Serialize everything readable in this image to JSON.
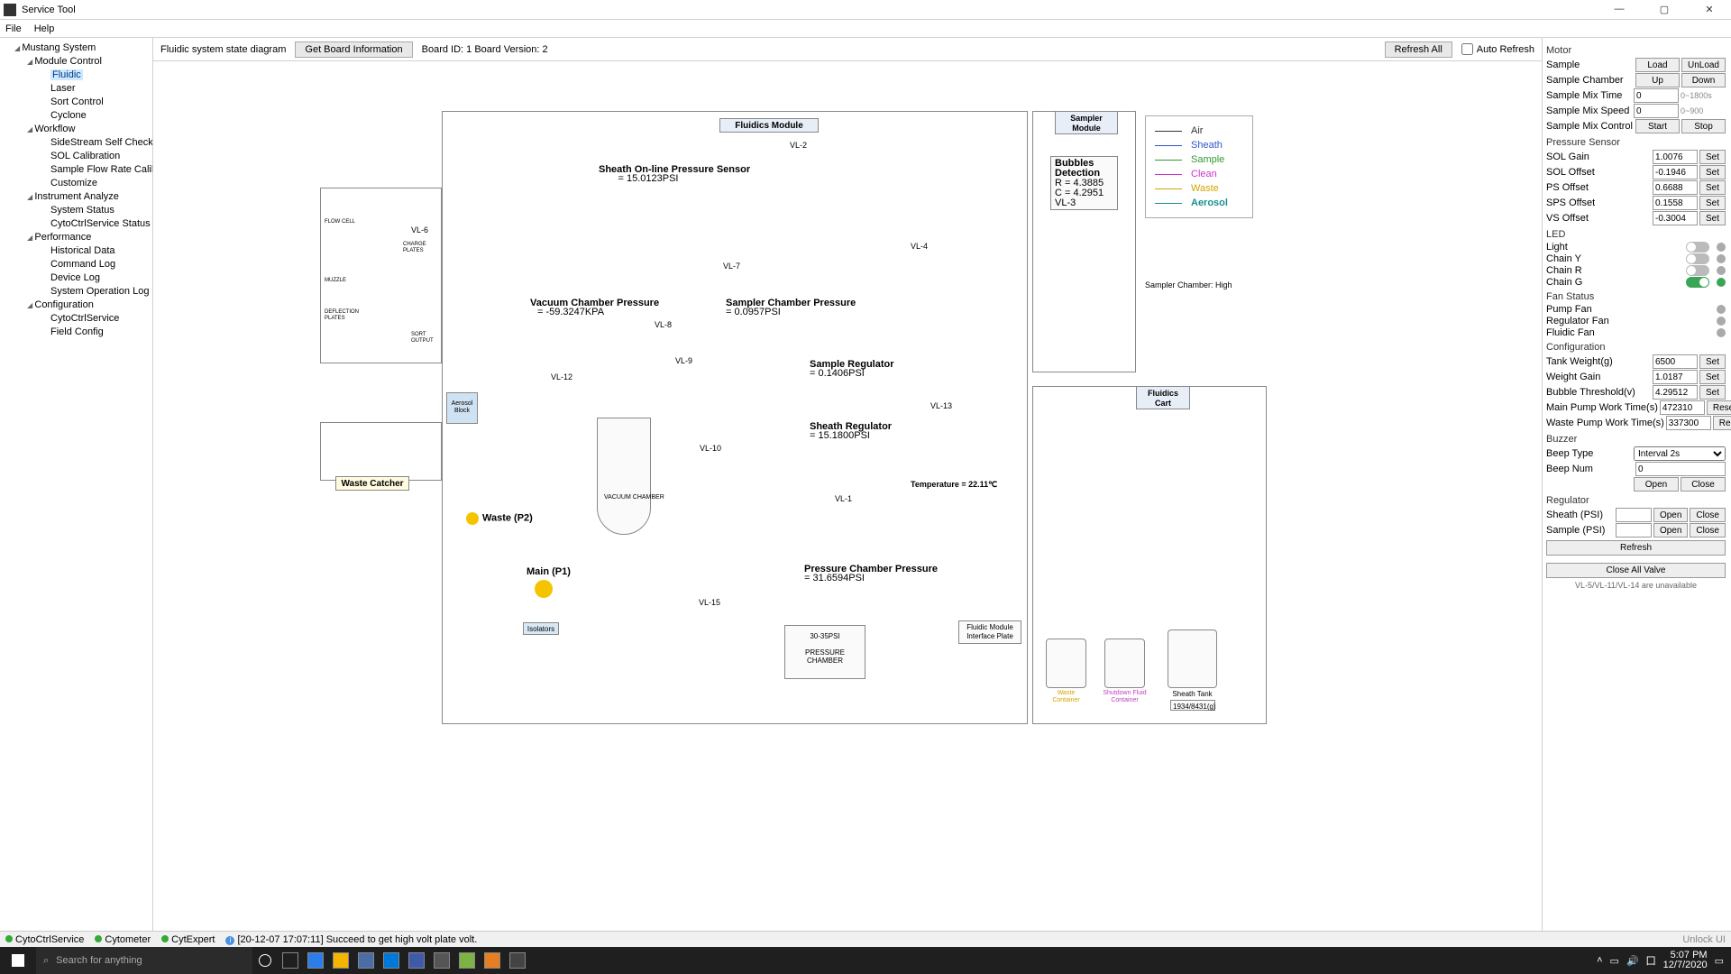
{
  "window": {
    "title": "Service Tool"
  },
  "menu": {
    "file": "File",
    "help": "Help"
  },
  "tree": {
    "root": "Mustang System",
    "groups": [
      {
        "label": "Module Control",
        "items": [
          "Fluidic",
          "Laser",
          "Sort Control",
          "Cyclone"
        ],
        "selected_index": 0
      },
      {
        "label": "Workflow",
        "items": [
          "SideStream Self Check",
          "SOL Calibration",
          "Sample Flow Rate Calibration",
          "Customize"
        ]
      },
      {
        "label": "Instrument Analyze",
        "items": [
          "System Status",
          "CytoCtrlService Status"
        ]
      },
      {
        "label": "Performance",
        "items": [
          "Historical Data",
          "Command Log",
          "Device Log",
          "System Operation Log"
        ]
      },
      {
        "label": "Configuration",
        "items": [
          "CytoCtrlService",
          "Field Config"
        ]
      }
    ]
  },
  "center_header": {
    "title": "Fluidic system state diagram",
    "get_board_btn": "Get Board Information",
    "board_info": "Board ID: 1 Board Version: 2",
    "refresh_all": "Refresh All",
    "auto_refresh": "Auto Refresh"
  },
  "diagram": {
    "fluidics_module": "Fluidics Module",
    "sampler_module": "Sampler Module",
    "fluidics_cart": "Fluidics Cart",
    "waste_catcher": "Waste Catcher",
    "aerosol_block": "Aerosol Block",
    "vacuum_chamber": "VACUUM CHAMBER",
    "pressure_chamber_box": "30-35PSI\nPRESSURE CHAMBER",
    "interface_plate": "Fluidic Module Interface Plate",
    "sheath_sensor": "Sheath On-line Pressure Sensor",
    "sheath_sensor_val": "= 15.0123PSI",
    "vacuum_pressure": "Vacuum Chamber Pressure",
    "vacuum_pressure_val": "= -59.3247KPA",
    "sampler_pressure": "Sampler Chamber Pressure",
    "sampler_pressure_val": "= 0.0957PSI",
    "sample_regulator": "Sample Regulator",
    "sample_regulator_val": "= 0.1406PSI",
    "sheath_regulator": "Sheath Regulator",
    "sheath_regulator_val": "= 15.1800PSI",
    "pressure_chamber_p": "Pressure Chamber Pressure",
    "pressure_chamber_val": "= 31.6594PSI",
    "temperature": "Temperature = 22.11℃",
    "bubble_detection": "Bubbles Detection",
    "bubble_r": "R = 4.3885",
    "bubble_c": "C = 4.2951",
    "main_p1": "Main (P1)",
    "waste_p2": "Waste (P2)",
    "isolators": "Isolators",
    "sampler_chamber_status": "Sampler Chamber: High",
    "sheath_tank": "Sheath Tank",
    "sheath_tank_val": "1934/8431(g)",
    "waste_container": "Waste Container",
    "shutdown_container": "Shutdown Fluid Container",
    "flow_cell": "FLOW CELL",
    "charge_plates": "CHARGE PLATES",
    "deflection_plates": "DEFLECTION PLATES",
    "sort_output": "SORT OUTPUT",
    "muzzle": "MUZZLE",
    "valves": {
      "vl1": "VL-1",
      "vl2": "VL-2",
      "vl3": "VL-3",
      "vl4": "VL-4",
      "vl6": "VL-6",
      "vl7": "VL-7",
      "vl8": "VL-8",
      "vl9": "VL-9",
      "vl10": "VL-10",
      "vl12": "VL-12",
      "vl13": "VL-13",
      "vl15": "VL-15"
    }
  },
  "legend": {
    "air": "Air",
    "sheath": "Sheath",
    "sample": "Sample",
    "clean": "Clean",
    "waste": "Waste",
    "aerosol": "Aerosol"
  },
  "rpanel": {
    "motor": {
      "title": "Motor",
      "sample": "Sample",
      "load": "Load",
      "unload": "UnLoad",
      "chamber": "Sample Chamber",
      "up": "Up",
      "down": "Down",
      "mix_time": "Sample Mix Time",
      "mix_time_val": "0",
      "mix_time_hint": "0~1800s",
      "mix_speed": "Sample Mix Speed",
      "mix_speed_val": "0",
      "mix_speed_hint": "0~900",
      "mix_ctrl": "Sample Mix Control",
      "start": "Start",
      "stop": "Stop"
    },
    "pressure_sensor": {
      "title": "Pressure Sensor",
      "rows": [
        {
          "label": "SOL Gain",
          "val": "1.0076"
        },
        {
          "label": "SOL Offset",
          "val": "-0.1946"
        },
        {
          "label": "PS Offset",
          "val": "0.6688"
        },
        {
          "label": "SPS Offset",
          "val": "0.1558"
        },
        {
          "label": "VS Offset",
          "val": "-0.3004"
        }
      ],
      "set": "Set"
    },
    "led": {
      "title": "LED",
      "rows": [
        {
          "label": "Light",
          "on": false
        },
        {
          "label": "Chain Y",
          "on": false
        },
        {
          "label": "Chain R",
          "on": false
        },
        {
          "label": "Chain G",
          "on": true
        }
      ]
    },
    "fan": {
      "title": "Fan Status",
      "rows": [
        "Pump Fan",
        "Regulator Fan",
        "Fluidic Fan"
      ]
    },
    "config": {
      "title": "Configuration",
      "rows": [
        {
          "label": "Tank Weight(g)",
          "val": "6500",
          "btn": "Set"
        },
        {
          "label": "Weight Gain",
          "val": "1.0187",
          "btn": "Set"
        },
        {
          "label": "Bubble Threshold(v)",
          "val": "4.29512",
          "btn": "Set"
        },
        {
          "label": "Main Pump Work Time(s)",
          "val": "472310",
          "btn": "Reset"
        },
        {
          "label": "Waste Pump Work Time(s)",
          "val": "337300",
          "btn": "Reset"
        }
      ]
    },
    "buzzer": {
      "title": "Buzzer",
      "beep_type": "Beep Type",
      "beep_type_val": "Interval 2s",
      "beep_num": "Beep Num",
      "beep_num_val": "0",
      "open": "Open",
      "close": "Close"
    },
    "regulator": {
      "title": "Regulator",
      "rows": [
        {
          "label": "Sheath (PSI)",
          "val": ""
        },
        {
          "label": "Sample (PSI)",
          "val": ""
        }
      ],
      "open": "Open",
      "close": "Close",
      "refresh": "Refresh"
    },
    "close_all": "Close All Valve",
    "valve_note": "VL-5/VL-11/VL-14 are unavailable"
  },
  "status": {
    "s1": "CytoCtrlService",
    "s2": "Cytometer",
    "s3": "CytExpert",
    "msg": "[20-12-07 17:07:11] Succeed to get high volt plate volt.",
    "unlock": "Unlock UI"
  },
  "taskbar": {
    "search_placeholder": "Search for anything",
    "time": "5:07 PM",
    "date": "12/7/2020"
  }
}
